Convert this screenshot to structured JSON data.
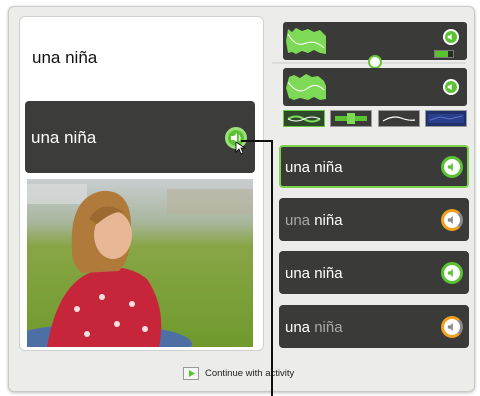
{
  "prompt": {
    "text": "una niña"
  },
  "answer_card": {
    "text": "una niña"
  },
  "choices": [
    {
      "pre": "",
      "main": "una niña",
      "post": ""
    },
    {
      "pre": "una ",
      "main": "niña",
      "post": ""
    },
    {
      "pre": "",
      "main": "una niña",
      "post": ""
    },
    {
      "pre": "",
      "main": "una ",
      "post": "niña"
    }
  ],
  "footer": {
    "continue_label": "Continue with activity"
  },
  "colors": {
    "accent": "#6ac53c",
    "panel": "#3a3a38",
    "orange": "#f0a020"
  }
}
